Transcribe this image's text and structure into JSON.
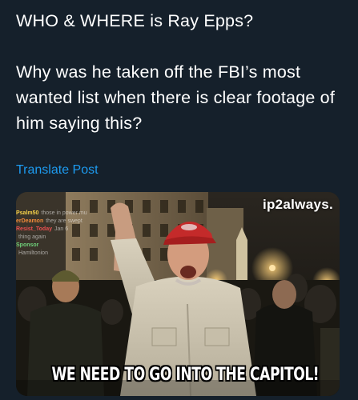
{
  "post": {
    "paragraphs": [
      "WHO & WHERE is Ray Epps?",
      "Why was he taken off the FBI’s most wanted list when there is clear footage of him saying this?"
    ],
    "translate_label": "Translate Post"
  },
  "media": {
    "watermark": "ip2always.",
    "caption": "WE NEED TO GO INTO THE CAPITOL!",
    "chat": [
      {
        "user": "Psalm50",
        "text": "those in power mu",
        "color": "yellow"
      },
      {
        "user": "erDeamon",
        "text": "they are swept",
        "color": "orange"
      },
      {
        "user": "Resist_Today",
        "text": "Jan 6",
        "color": "red"
      },
      {
        "user": "",
        "text": "thing again",
        "color": "purple"
      },
      {
        "user": "Sponsor",
        "text": "",
        "color": "green"
      },
      {
        "user": "",
        "text": "Hamiltonion",
        "color": "yellow"
      }
    ]
  }
}
